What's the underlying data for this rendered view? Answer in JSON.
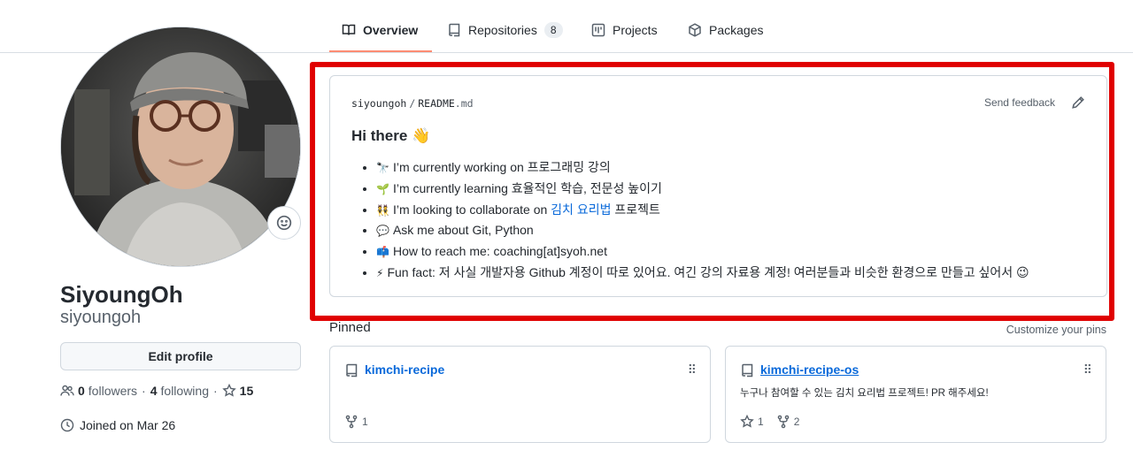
{
  "tabs": [
    {
      "label": "Overview",
      "icon": "book-icon",
      "active": true
    },
    {
      "label": "Repositories",
      "icon": "repo-icon",
      "count": "8"
    },
    {
      "label": "Projects",
      "icon": "project-icon"
    },
    {
      "label": "Packages",
      "icon": "package-icon"
    }
  ],
  "profile": {
    "full_name": "SiyoungOh",
    "login": "siyoungoh",
    "edit_label": "Edit profile",
    "followers_count": "0",
    "followers_label": "followers",
    "following_count": "4",
    "following_label": "following",
    "stars_count": "15",
    "joined": "Joined on Mar 26",
    "status_icon": "smiley-icon"
  },
  "readme": {
    "owner": "siyoungoh",
    "file": "README",
    "ext": ".md",
    "feedback": "Send feedback",
    "heading": "Hi there 👋",
    "items": [
      {
        "emoji": "🔭",
        "text": "I’m currently working on 프로그래밍 강의"
      },
      {
        "emoji": "🌱",
        "text": "I’m currently learning 효율적인 학습, 전문성 높이기"
      },
      {
        "emoji": "👯",
        "before": "I’m looking to collaborate on ",
        "link": "김치 요리법",
        "after": " 프로젝트"
      },
      {
        "emoji": "💬",
        "text": "Ask me about Git, Python"
      },
      {
        "emoji": "📫",
        "text": "How to reach me: coaching[at]syoh.net"
      },
      {
        "emoji": "⚡",
        "text": "Fun fact: 저 사실 개발자용 Github 계정이 따로 있어요. 여긴 강의 자료용 계정! 여러분들과 비슷한 환경으로 만들고 싶어서 😉"
      }
    ]
  },
  "pinned": {
    "title": "Pinned",
    "customize": "Customize your pins",
    "cards": [
      {
        "name": "kimchi-recipe",
        "description": "",
        "forks": "1"
      },
      {
        "name": "kimchi-recipe-os",
        "description": "누구나 참여할 수 있는 김치 요리법 프로젝트! PR 해주세요!",
        "stars": "1",
        "forks": "2"
      }
    ]
  },
  "colors": {
    "highlight": "#e00000",
    "link": "#0969da",
    "tab_underline": "#fd8c73"
  }
}
